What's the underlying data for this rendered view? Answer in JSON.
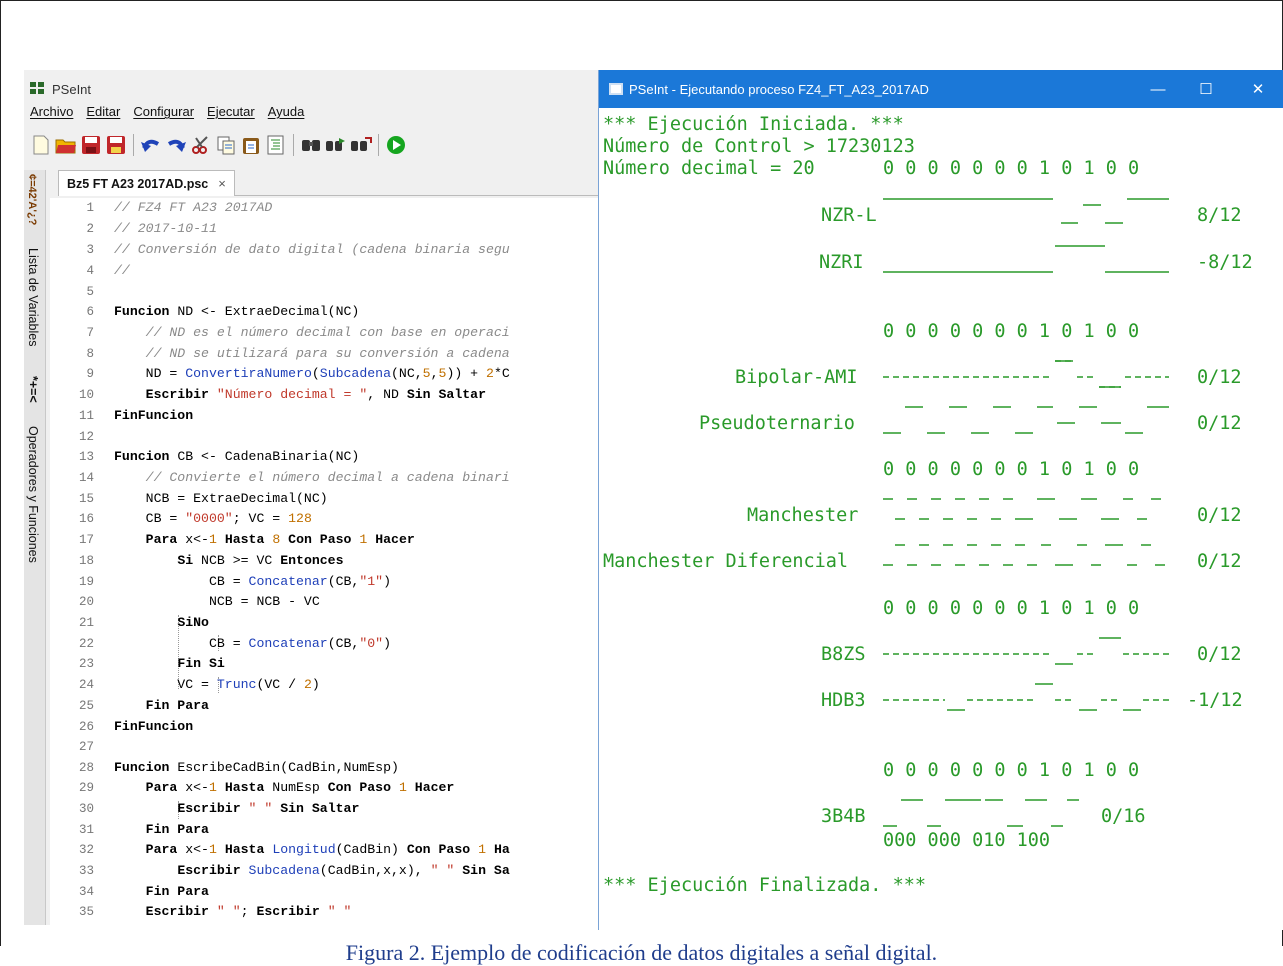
{
  "ide": {
    "title": "PSeInt",
    "menu": [
      "Archivo",
      "Editar",
      "Configurar",
      "Ejecutar",
      "Ayuda"
    ],
    "tab_label": "Bz5 FT A23 2017AD.psc",
    "tab_close": "×",
    "sidebar": {
      "top_icons": "¢=42'A'¿?",
      "variables": "Lista de Variables",
      "operators_icons": "*+=<",
      "operators": "Operadores y Funciones"
    },
    "line_numbers": [
      "1",
      "2",
      "3",
      "4",
      "5",
      "6",
      "7",
      "8",
      "9",
      "10",
      "11",
      "12",
      "13",
      "14",
      "15",
      "16",
      "17",
      "18",
      "19",
      "20",
      "21",
      "22",
      "23",
      "24",
      "25",
      "26",
      "27",
      "28",
      "29",
      "30",
      "31",
      "32",
      "33",
      "34",
      "35"
    ]
  },
  "console": {
    "title": "PSeInt - Ejecutando proceso FZ4_FT_A23_2017AD",
    "btn_minimize": "—",
    "btn_maximize": "☐",
    "btn_close": "✕",
    "lines": {
      "start": "*** Ejecución Iniciada. ***",
      "control": "Número de Control > 17230123",
      "decimal": "Número decimal = 20",
      "bits": "0 0 0 0 0 0 0 1 0 1 0 0",
      "nzrl_label": "NZR-L",
      "nzrl_score": "8/12",
      "nzri_label": "NZRI",
      "nzri_score": "-8/12",
      "bits2": "0 0 0 0 0 0 0 1 0 1 0 0",
      "ami_label": "Bipolar-AMI",
      "ami_score": "0/12",
      "pseudo_label": "Pseudoternario",
      "pseudo_score": "0/12",
      "bits3": "0 0 0 0 0 0 0 1 0 1 0 0",
      "manch_label": "Manchester",
      "manch_score": "0/12",
      "dman_label": "Manchester Diferencial",
      "dman_score": "0/12",
      "bits4": "0 0 0 0 0 0 0 1 0 1 0 0",
      "b8zs_label": "B8ZS",
      "b8zs_score": "0/12",
      "hdb3_label": "HDB3",
      "hdb3_score": "-1/12",
      "bits5": "0 0 0 0 0 0 0 1 0 1 0 0",
      "b3b4_label": "3B4B",
      "b3b4_score": "0/16",
      "b3b4_groups": "000 000 010 100",
      "end": "*** Ejecución Finalizada. ***"
    }
  },
  "caption": "Figura 2. Ejemplo de codificación de datos digitales a señal digital."
}
